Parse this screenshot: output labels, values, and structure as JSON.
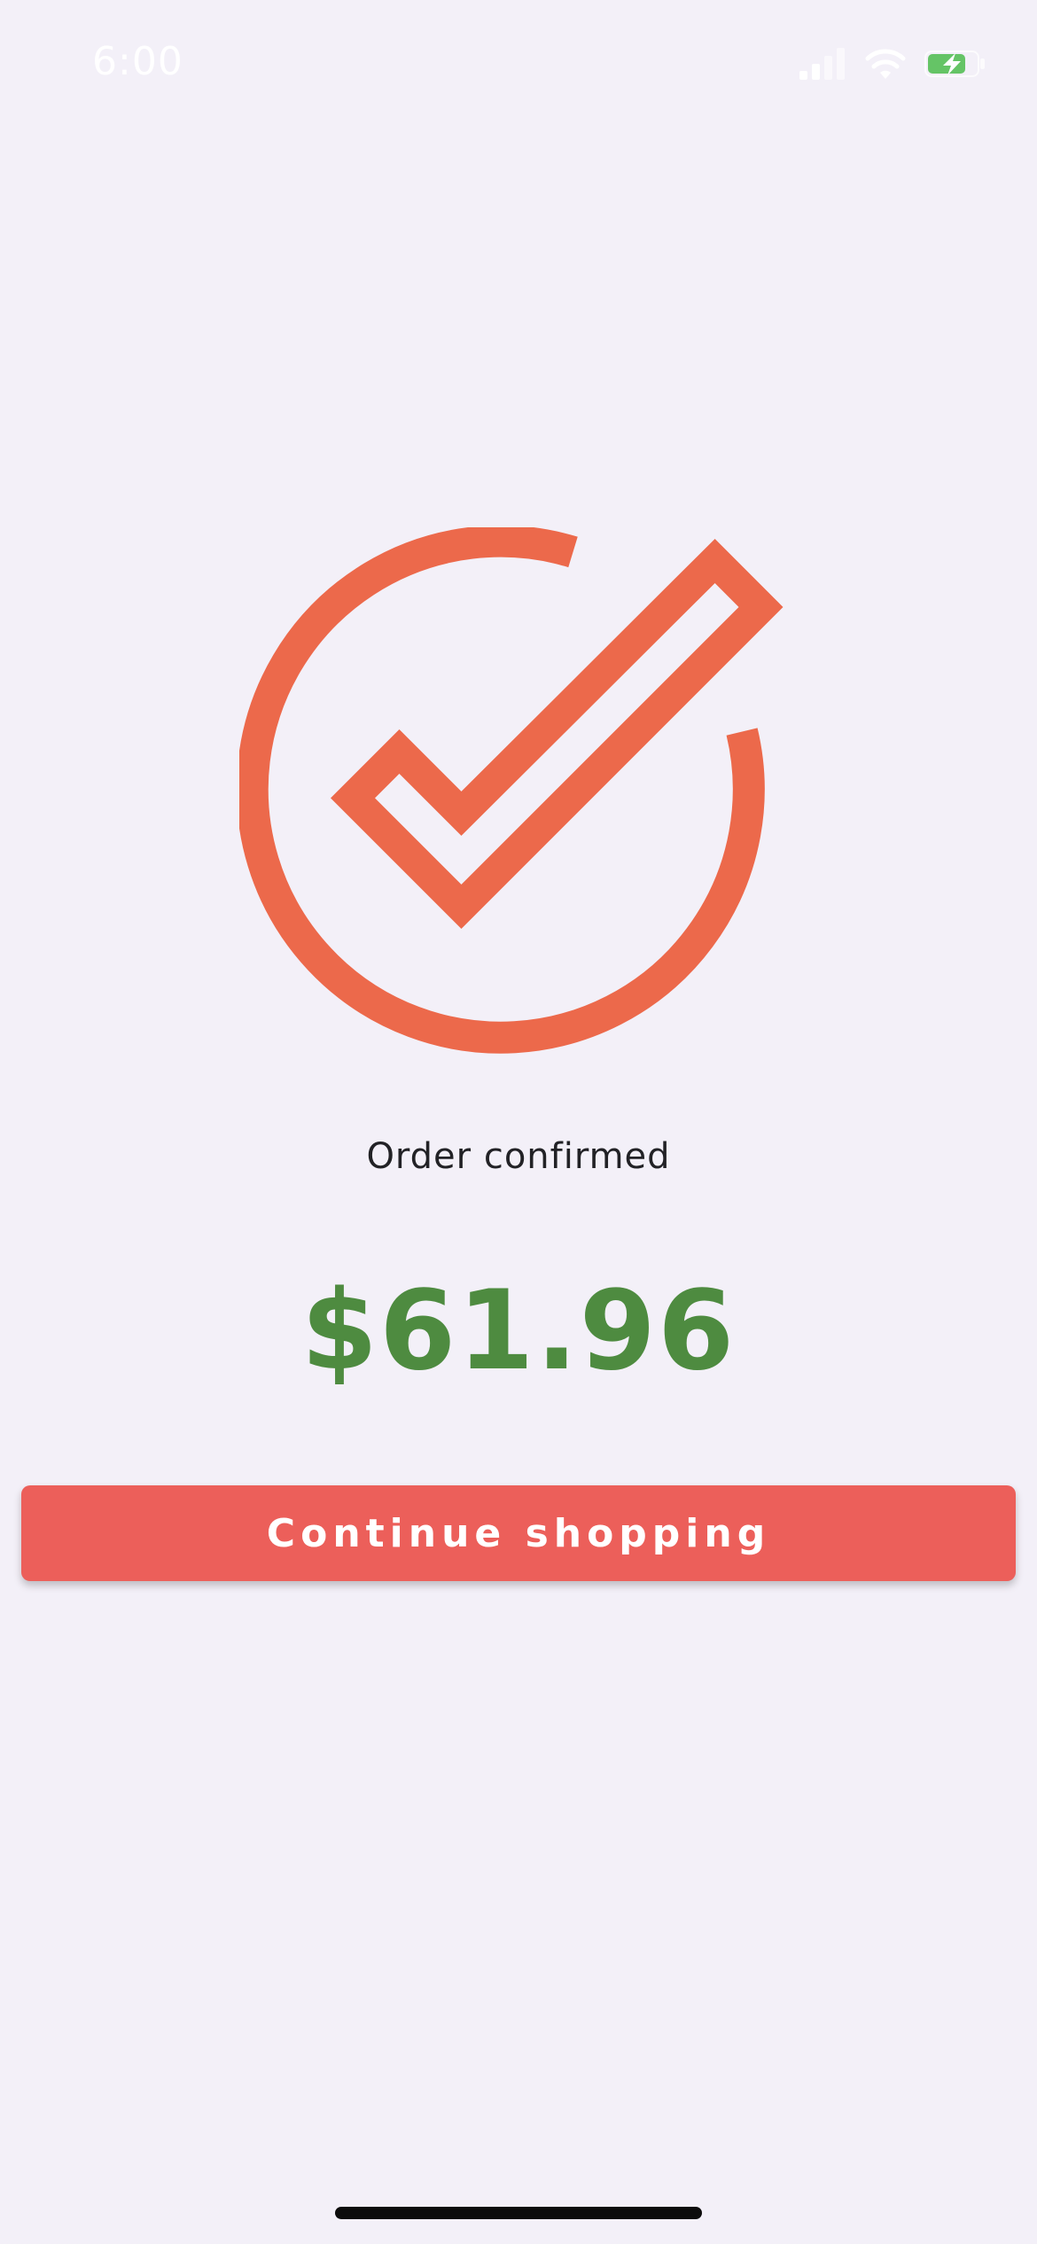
{
  "status_bar": {
    "time": "6:00",
    "icons": [
      "signal-icon",
      "wifi-icon",
      "battery-charging-icon"
    ]
  },
  "confirmation": {
    "icon": "check-circle-icon",
    "title": "Order confirmed",
    "total": "$61.96"
  },
  "actions": {
    "continue_label": "Continue shopping"
  },
  "colors": {
    "background": "#f3f0f8",
    "icon_accent": "#ec694b",
    "total_green": "#4e8b40",
    "button": "#ec5f5a",
    "battery_green": "#65c466"
  }
}
